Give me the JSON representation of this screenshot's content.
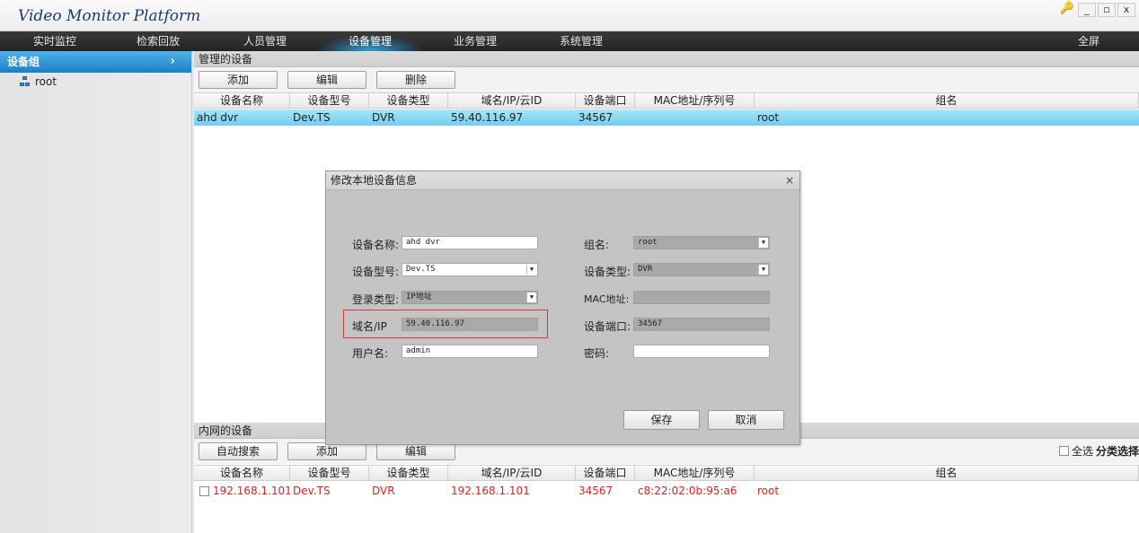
{
  "app": {
    "title": "Video Monitor Platform"
  },
  "window_controls": {
    "settings": "🔑",
    "minimize": "_",
    "maximize": "▫",
    "close": "x"
  },
  "nav": {
    "items": [
      "实时监控",
      "检索回放",
      "人员管理",
      "设备管理",
      "业务管理",
      "系统管理"
    ],
    "fullscreen": "全屏",
    "active_index": 3
  },
  "sidebar": {
    "header": "设备组",
    "chevron": "›",
    "tree": [
      {
        "label": "root"
      }
    ]
  },
  "managed": {
    "label": "管理的设备",
    "buttons": {
      "add": "添加",
      "edit": "编辑",
      "delete": "删除"
    },
    "columns": [
      "设备名称",
      "设备型号",
      "设备类型",
      "域名/IP/云ID",
      "设备端口",
      "MAC地址/序列号",
      "组名"
    ],
    "rows": [
      {
        "name": "ahd dvr",
        "model": "Dev.TS",
        "type": "DVR",
        "ip": "59.40.116.97",
        "port": "34567",
        "mac": "",
        "group": "root"
      }
    ]
  },
  "lan": {
    "label": "内网的设备",
    "buttons": {
      "auto_search": "自动搜索",
      "add": "添加",
      "edit": "编辑"
    },
    "select_all": "全选",
    "classify": "分类选择",
    "columns": [
      "设备名称",
      "设备型号",
      "设备类型",
      "域名/IP/云ID",
      "设备端口",
      "MAC地址/序列号",
      "组名"
    ],
    "rows": [
      {
        "name": "192.168.1.101",
        "model": "Dev.TS",
        "type": "DVR",
        "ip": "192.168.1.101",
        "port": "34567",
        "mac": "c8:22:02:0b:95:a6",
        "group": "root"
      }
    ]
  },
  "dialog": {
    "title": "修改本地设备信息",
    "close": "×",
    "fields": {
      "device_name": {
        "label": "设备名称:",
        "value": "ahd dvr"
      },
      "device_model": {
        "label": "设备型号:",
        "value": "Dev.TS"
      },
      "login_type": {
        "label": "登录类型:",
        "value": "IP地址"
      },
      "domain_ip": {
        "label": "域名/IP",
        "value": "59.40.116.97"
      },
      "username": {
        "label": "用户名:",
        "value": "admin"
      },
      "group": {
        "label": "组名:",
        "value": "root"
      },
      "device_type": {
        "label": "设备类型:",
        "value": "DVR"
      },
      "mac": {
        "label": "MAC地址:",
        "value": ""
      },
      "port": {
        "label": "设备端口:",
        "value": "34567"
      },
      "password": {
        "label": "密码:",
        "value": ""
      }
    },
    "buttons": {
      "save": "保存",
      "cancel": "取消"
    }
  },
  "colors": {
    "accent": "#1b7fc4",
    "selected_row": "#74cdf0",
    "lan_text": "#d8221f",
    "highlight": "#d53a3a"
  }
}
